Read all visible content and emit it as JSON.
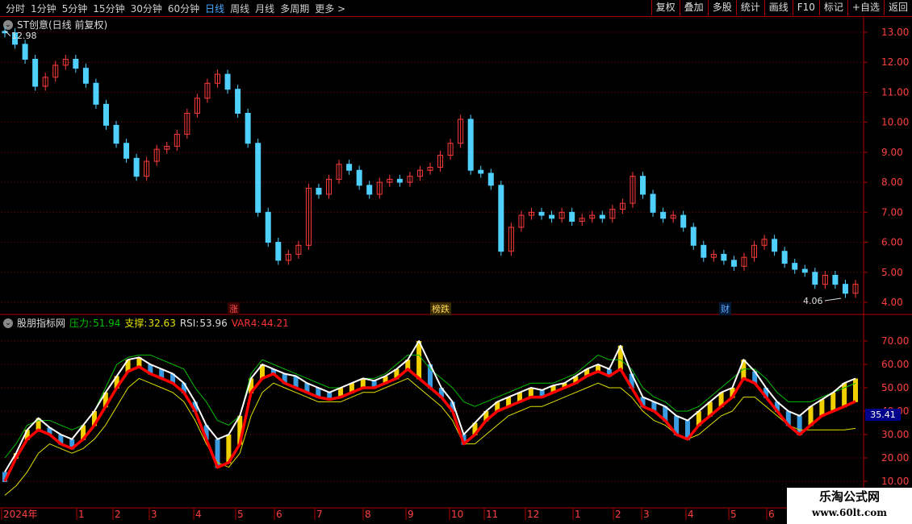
{
  "toolbar": {
    "timeframes": [
      "分时",
      "1分钟",
      "5分钟",
      "15分钟",
      "30分钟",
      "60分钟",
      "日线",
      "周线",
      "月线",
      "多周期",
      "更多 >"
    ],
    "active": "日线",
    "right_buttons": [
      "复权",
      "叠加",
      "多股",
      "统计",
      "画线",
      "F10",
      "标记",
      "+自选",
      "返回"
    ]
  },
  "price_panel": {
    "title": "ST创意(日线 前复权)",
    "high_label": "12.98",
    "low_label": "4.06",
    "y_ticks": [
      "13.00",
      "12.00",
      "11.00",
      "10.00",
      "9.00",
      "8.00",
      "7.00",
      "6.00",
      "5.00",
      "4.00"
    ],
    "events": [
      {
        "text": "涨",
        "color": "#ff5555",
        "bg": "#3a0000"
      },
      {
        "text": "榜跌",
        "color": "#ffdd55",
        "bg": "#3a2a00"
      },
      {
        "text": "财",
        "color": "#66aaff",
        "bg": "#001a3a"
      }
    ]
  },
  "indicator_panel": {
    "name": "股朋指标网",
    "pressure_label": "压力:",
    "pressure": "51.94",
    "support_label": "支撑:",
    "support": "32.63",
    "rsi_label": "RSI:",
    "rsi": "53.96",
    "var4_label": "VAR4:",
    "var4": "44.21",
    "y_ticks": [
      "70.00",
      "60.00",
      "50.00",
      "40.00",
      "30.00",
      "20.00",
      "10.00"
    ],
    "current_value": "35.41"
  },
  "x_axis": {
    "labels": [
      "2024年",
      "1",
      "2",
      "3",
      "4",
      "5",
      "6",
      "7",
      "8",
      "9",
      "10",
      "11",
      "12",
      "1",
      "2",
      "3",
      "4",
      "5",
      "6"
    ]
  },
  "watermark": {
    "line1": "乐淘公式网",
    "line2": "www.60lt.com"
  },
  "colors": {
    "up": "#ff3b3b",
    "down": "#4fd0ff",
    "grid": "#8a0000",
    "pressure": "#00c000",
    "support": "#e0e000",
    "rsi": "#ffffff",
    "var4": "#ff0000"
  },
  "chart_data": [
    {
      "type": "candlestick",
      "title": "ST创意(日线 前复权)",
      "ylim": [
        3.8,
        13.3
      ],
      "close_series": [
        12.98,
        12.6,
        12.1,
        11.2,
        11.5,
        11.9,
        12.1,
        11.8,
        11.3,
        10.6,
        9.9,
        9.3,
        8.8,
        8.2,
        8.7,
        9.1,
        9.2,
        9.6,
        10.3,
        10.8,
        11.3,
        11.6,
        11.1,
        10.3,
        9.3,
        7.0,
        6.0,
        5.4,
        5.6,
        5.9,
        7.8,
        7.6,
        8.1,
        8.6,
        8.4,
        7.9,
        7.6,
        8.0,
        8.1,
        8.0,
        8.2,
        8.4,
        8.5,
        8.9,
        9.3,
        10.1,
        8.4,
        8.3,
        7.9,
        5.7,
        6.5,
        6.9,
        7.0,
        6.9,
        6.8,
        7.0,
        6.7,
        6.8,
        6.9,
        6.8,
        7.1,
        7.3,
        8.2,
        7.6,
        7.0,
        6.8,
        6.9,
        6.5,
        5.9,
        5.5,
        5.6,
        5.4,
        5.2,
        5.5,
        5.9,
        6.1,
        5.7,
        5.3,
        5.1,
        5.0,
        4.6,
        4.9,
        4.6,
        4.3,
        4.6
      ],
      "annotations": [
        "12.98",
        "4.06"
      ]
    },
    {
      "type": "line",
      "title": "股朋指标网",
      "ylim": [
        2,
        78
      ],
      "series": [
        {
          "name": "RSI",
          "values": [
            14,
            22,
            32,
            37,
            33,
            30,
            28,
            34,
            40,
            48,
            55,
            62,
            63,
            60,
            58,
            56,
            52,
            44,
            34,
            28,
            30,
            38,
            54,
            60,
            58,
            56,
            55,
            52,
            50,
            48,
            50,
            52,
            54,
            53,
            55,
            58,
            62,
            70,
            60,
            50,
            44,
            30,
            35,
            40,
            44,
            46,
            48,
            50,
            49,
            51,
            52,
            55,
            58,
            60,
            58,
            68,
            56,
            46,
            44,
            42,
            38,
            36,
            40,
            44,
            48,
            50,
            62,
            57,
            50,
            44,
            40,
            38,
            42,
            45,
            48,
            52,
            53.96
          ]
        },
        {
          "name": "VAR4",
          "values": [
            10,
            20,
            28,
            32,
            30,
            26,
            24,
            28,
            34,
            42,
            50,
            57,
            59,
            56,
            54,
            52,
            48,
            40,
            28,
            16,
            18,
            26,
            48,
            54,
            56,
            52,
            50,
            48,
            46,
            45,
            46,
            48,
            50,
            50,
            52,
            54,
            58,
            54,
            50,
            46,
            40,
            26,
            30,
            36,
            40,
            42,
            44,
            46,
            46,
            48,
            50,
            52,
            55,
            57,
            55,
            58,
            50,
            42,
            40,
            36,
            30,
            28,
            34,
            38,
            42,
            46,
            54,
            52,
            46,
            40,
            34,
            30,
            34,
            38,
            40,
            42,
            44.21
          ]
        },
        {
          "name": "压力",
          "values": [
            20,
            26,
            34,
            36,
            36,
            34,
            32,
            34,
            40,
            50,
            60,
            63,
            64,
            64,
            62,
            60,
            58,
            50,
            44,
            36,
            34,
            38,
            56,
            62,
            60,
            58,
            56,
            54,
            52,
            50,
            50,
            52,
            54,
            54,
            56,
            60,
            64,
            64,
            58,
            54,
            50,
            44,
            42,
            44,
            46,
            48,
            50,
            52,
            52,
            52,
            54,
            56,
            60,
            64,
            62,
            62,
            58,
            50,
            46,
            44,
            40,
            40,
            42,
            46,
            50,
            54,
            58,
            58,
            54,
            48,
            44,
            44,
            44,
            46,
            48,
            50,
            51.94
          ]
        },
        {
          "name": "支撑",
          "values": [
            4,
            8,
            14,
            22,
            26,
            24,
            22,
            24,
            28,
            34,
            42,
            50,
            54,
            52,
            50,
            48,
            44,
            36,
            26,
            18,
            16,
            22,
            38,
            48,
            52,
            50,
            48,
            46,
            44,
            44,
            44,
            46,
            48,
            48,
            50,
            52,
            54,
            50,
            46,
            42,
            36,
            26,
            26,
            30,
            34,
            38,
            40,
            42,
            42,
            44,
            46,
            48,
            50,
            52,
            50,
            50,
            46,
            40,
            36,
            34,
            30,
            28,
            30,
            34,
            38,
            40,
            46,
            46,
            42,
            38,
            34,
            32,
            32,
            32,
            32,
            32,
            32.63
          ]
        }
      ]
    }
  ]
}
